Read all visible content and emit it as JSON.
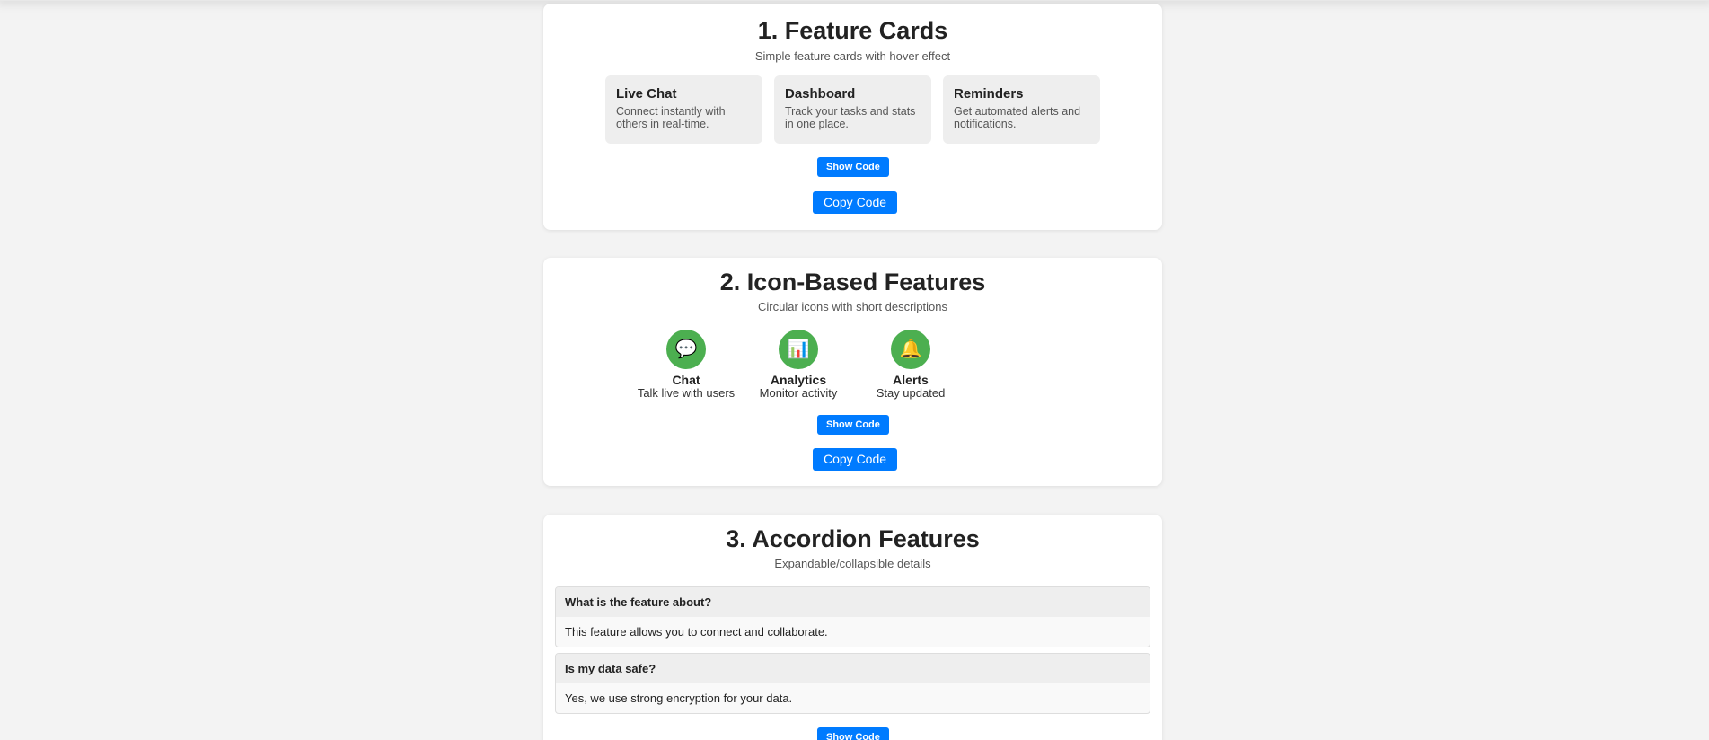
{
  "colors": {
    "page_background": "#f3f3f3",
    "card_background": "#ffffff",
    "button_blue": "#007bff",
    "icon_green": "#4caf50",
    "feature_card_gray": "#eeeeee"
  },
  "section1": {
    "title": "1. Feature Cards",
    "subtitle": "Simple feature cards with hover effect",
    "cards": [
      {
        "title": "Live Chat",
        "description": "Connect instantly with others in real-time."
      },
      {
        "title": "Dashboard",
        "description": "Track your tasks and stats in one place."
      },
      {
        "title": "Reminders",
        "description": "Get automated alerts and notifications."
      }
    ],
    "show_code_label": "Show Code",
    "copy_code_label": "Copy Code"
  },
  "section2": {
    "title": "2. Icon-Based Features",
    "subtitle": "Circular icons with short descriptions",
    "features": [
      {
        "icon": "speech-bubble-icon",
        "glyph": "💬",
        "title": "Chat",
        "description": "Talk live with users"
      },
      {
        "icon": "bar-chart-icon",
        "glyph": "📊",
        "title": "Analytics",
        "description": "Monitor activity"
      },
      {
        "icon": "bell-icon",
        "glyph": "🔔",
        "title": "Alerts",
        "description": "Stay updated"
      }
    ],
    "show_code_label": "Show Code",
    "copy_code_label": "Copy Code"
  },
  "section3": {
    "title": "3. Accordion Features",
    "subtitle": "Expandable/collapsible details",
    "items": [
      {
        "question": "What is the feature about?",
        "answer": "This feature allows you to connect and collaborate."
      },
      {
        "question": "Is my data safe?",
        "answer": "Yes, we use strong encryption for your data."
      }
    ],
    "show_code_label": "Show Code"
  }
}
